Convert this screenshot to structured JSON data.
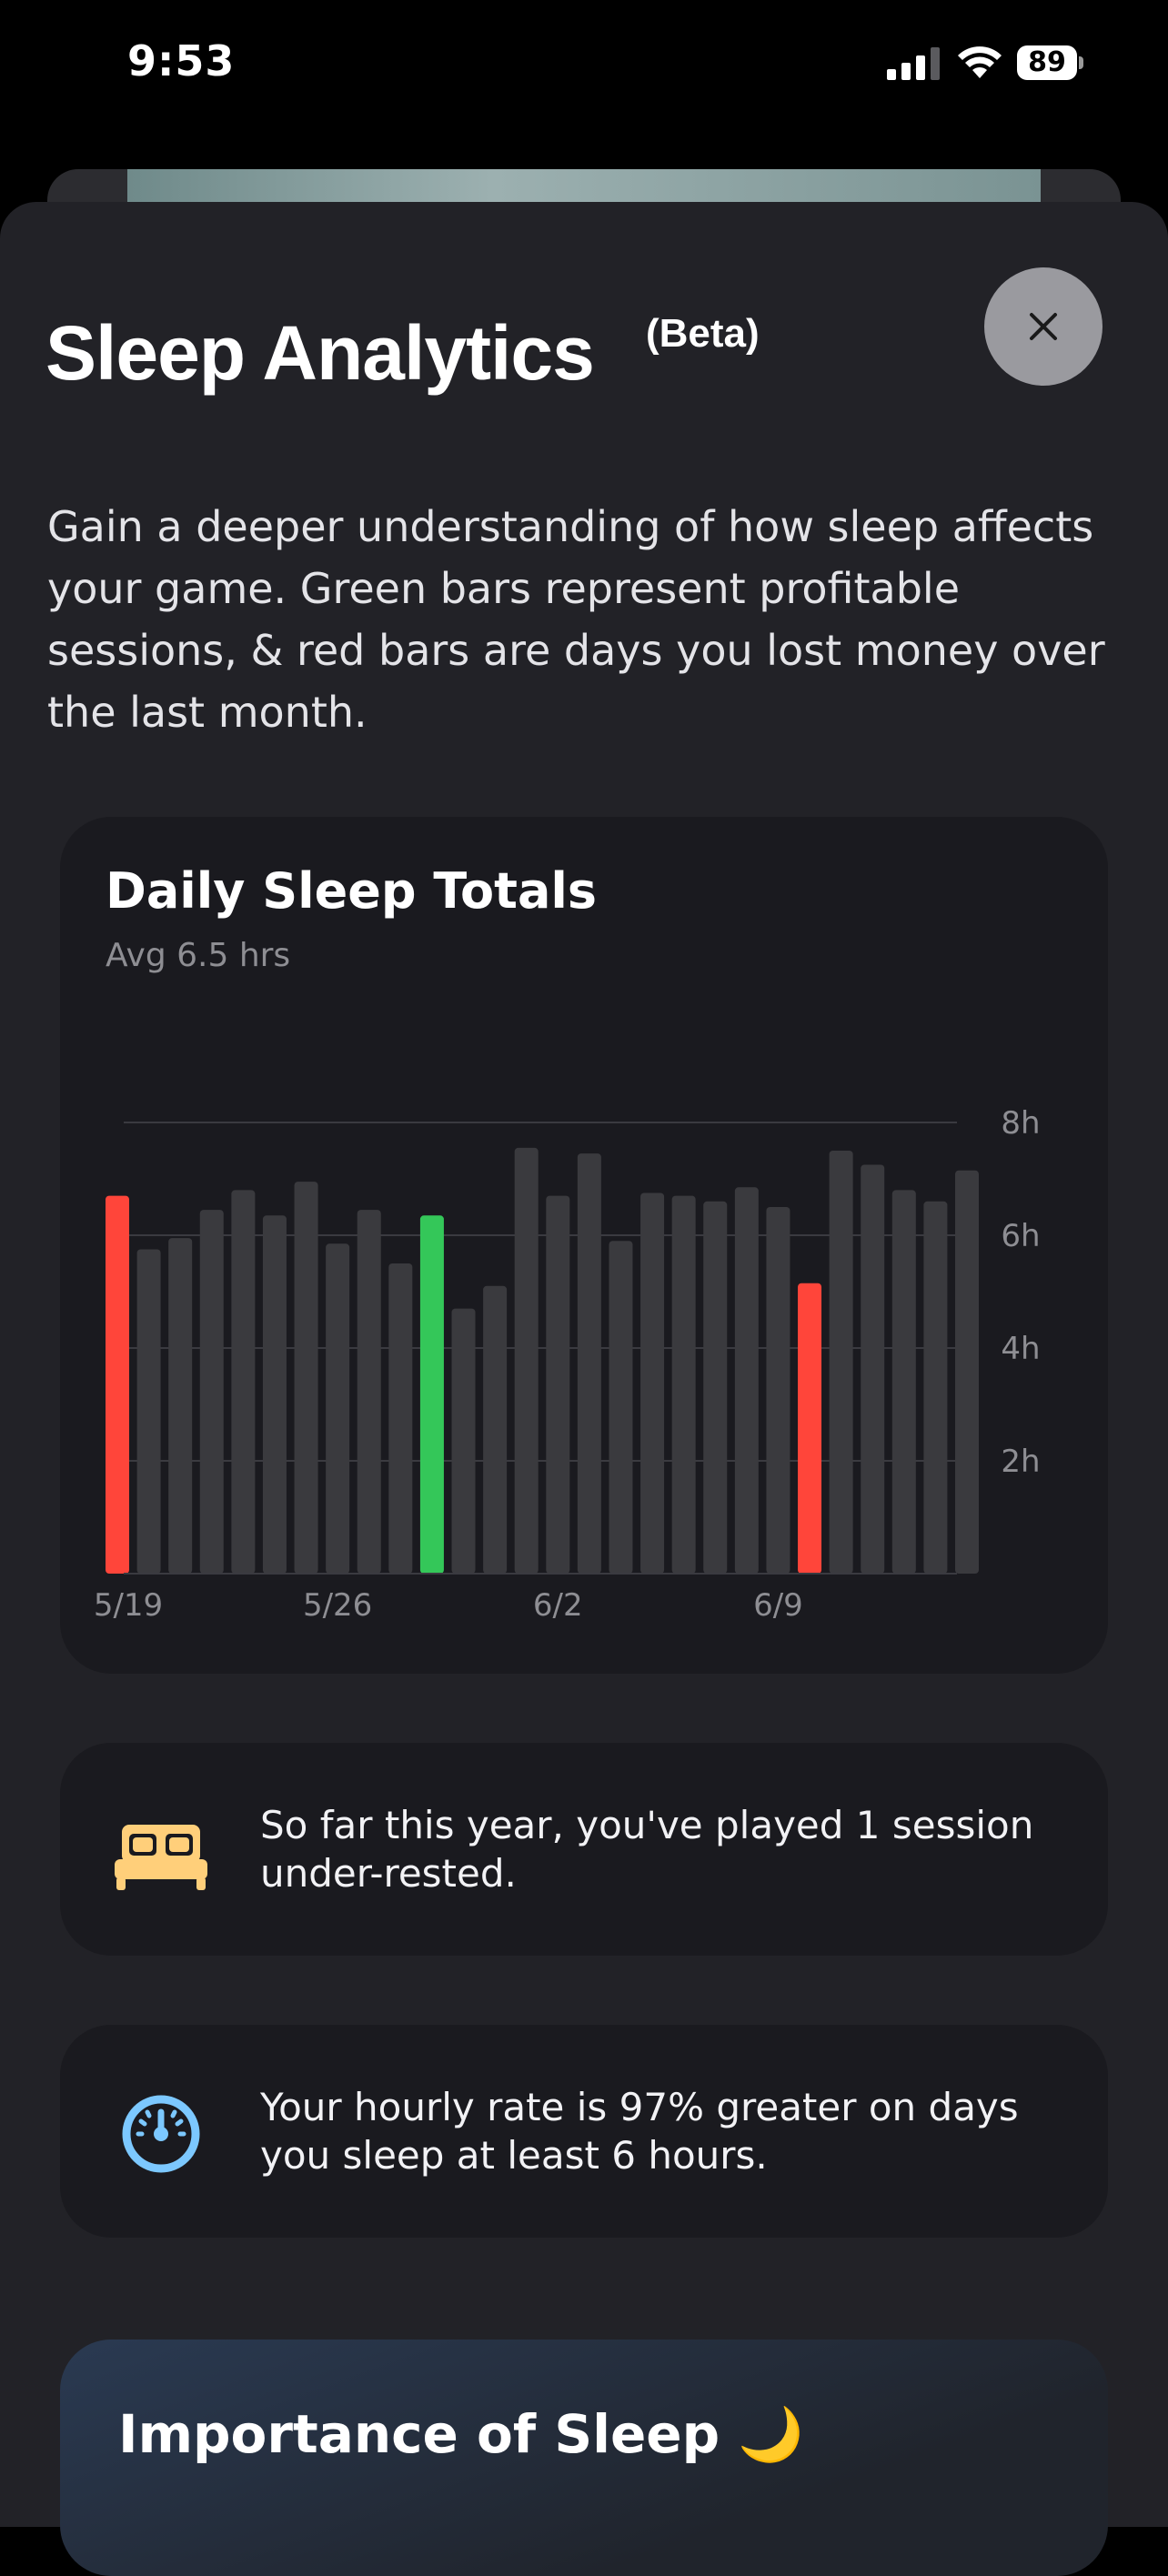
{
  "status_bar": {
    "time": "9:53",
    "battery": "89"
  },
  "header": {
    "title": "Sleep Analytics",
    "badge": "(Beta)"
  },
  "intro_text": "Gain a deeper understanding of how sleep affects your game. Green bars represent profitable sessions, & red bars are days you lost money over the last month.",
  "chart_card": {
    "title": "Daily Sleep Totals",
    "subtitle": "Avg 6.5 hrs"
  },
  "chart_data": {
    "type": "bar",
    "title": "Daily Sleep Totals",
    "subtitle": "Avg 6.5 hrs",
    "unit": "hours",
    "y_ticks": [
      "8h",
      "6h",
      "4h",
      "2h"
    ],
    "ylim": [
      0,
      8
    ],
    "x_tick_labels": [
      "5/19",
      "5/26",
      "6/2",
      "6/9"
    ],
    "grid": true,
    "colors": {
      "profitable": "#34c759",
      "loss": "#ff453a",
      "neutral": "#3a3a3e"
    },
    "values": [
      6.7,
      5.75,
      5.95,
      6.45,
      6.8,
      6.35,
      6.95,
      5.85,
      6.45,
      5.5,
      6.35,
      4.7,
      5.1,
      7.55,
      6.7,
      7.45,
      5.9,
      6.75,
      6.7,
      6.6,
      6.85,
      6.5,
      5.15,
      7.5,
      7.25,
      6.8,
      6.6,
      7.15
    ],
    "status": [
      "loss",
      "none",
      "none",
      "none",
      "none",
      "none",
      "none",
      "none",
      "none",
      "none",
      "profit",
      "none",
      "none",
      "none",
      "none",
      "none",
      "none",
      "none",
      "none",
      "none",
      "none",
      "none",
      "loss",
      "none",
      "none",
      "none",
      "none",
      "none"
    ]
  },
  "insights": [
    {
      "icon": "bed-icon",
      "text": "So far this year, you've played 1 session under-rested."
    },
    {
      "icon": "gauge-icon",
      "text": "Your hourly rate is 97% greater on days you sleep at least 6 hours."
    }
  ],
  "importance": {
    "title": "Importance of Sleep 🌙"
  }
}
